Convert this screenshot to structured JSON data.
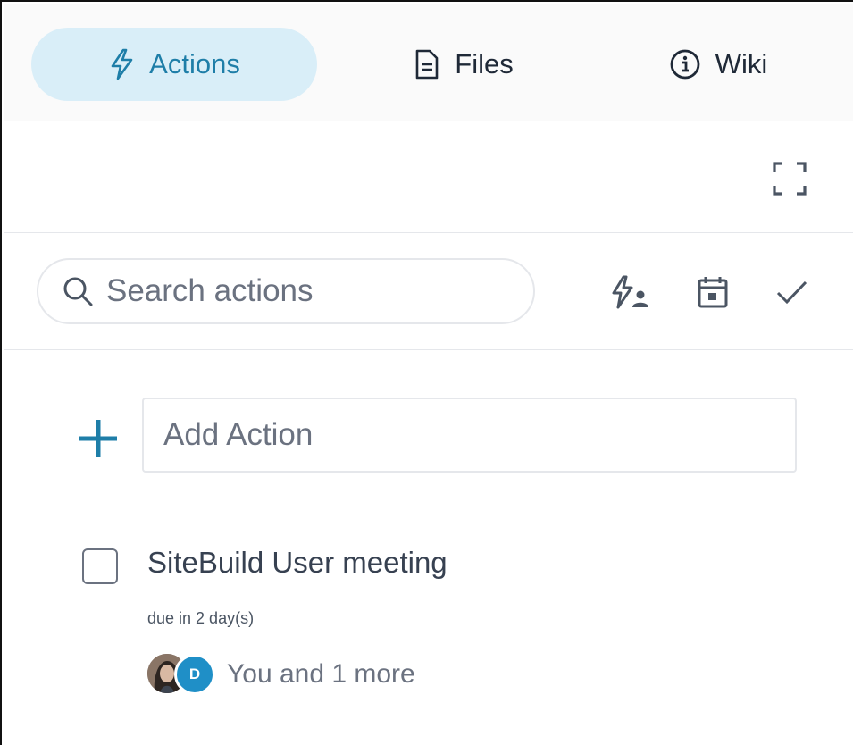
{
  "tabs": [
    {
      "label": "Actions",
      "icon": "lightning-icon",
      "active": true
    },
    {
      "label": "Files",
      "icon": "file-icon",
      "active": false
    },
    {
      "label": "Wiki",
      "icon": "info-icon",
      "active": false
    }
  ],
  "toolbar": {
    "expand_icon": "expand-icon"
  },
  "search": {
    "placeholder": "Search actions",
    "value": "",
    "filters": [
      "assigned-to-me-icon",
      "calendar-icon",
      "check-icon"
    ]
  },
  "add_action": {
    "placeholder": "Add Action",
    "value": ""
  },
  "actions": [
    {
      "title": "SiteBuild User meeting",
      "due": "due in 2 day(s)",
      "completed": false,
      "avatar_initial": "D",
      "assignees": "You and 1 more"
    }
  ],
  "colors": {
    "accent": "#1e7ea8",
    "active_tab_bg": "#d9eef8",
    "avatar_blue": "#1f8fc7"
  }
}
